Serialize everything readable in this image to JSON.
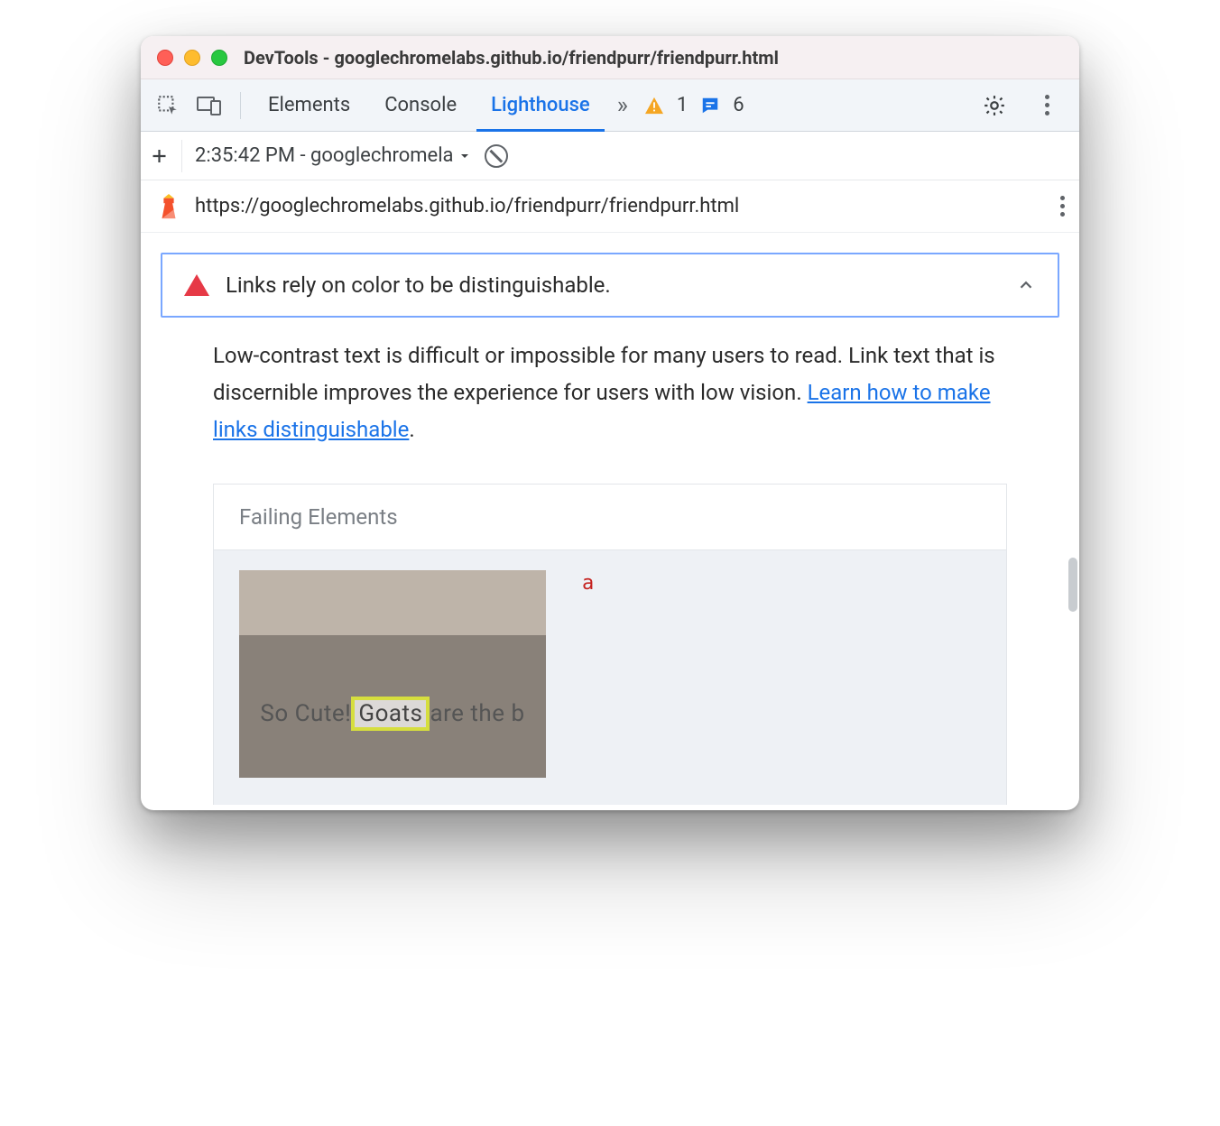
{
  "window": {
    "title": "DevTools - googlechromelabs.github.io/friendpurr/friendpurr.html"
  },
  "tabs": {
    "elements": "Elements",
    "console": "Console",
    "lighthouse": "Lighthouse"
  },
  "counters": {
    "warnings": "1",
    "messages": "6"
  },
  "lh_toolbar": {
    "report_label": "2:35:42 PM - googlechromela"
  },
  "url_row": {
    "url": "https://googlechromelabs.github.io/friendpurr/friendpurr.html"
  },
  "audit": {
    "title": "Links rely on color to be distinguishable.",
    "description_pre": "Low-contrast text is difficult or impossible for many users to read. Link text that is discernible improves the experience for users with low vision. ",
    "learn_link": "Learn how to make links distinguishable",
    "description_post": "."
  },
  "failing": {
    "header": "Failing Elements",
    "tag": "a",
    "thumb_text_pre": "So Cute! ",
    "thumb_highlight": "Goats",
    "thumb_text_post": " are the b"
  }
}
